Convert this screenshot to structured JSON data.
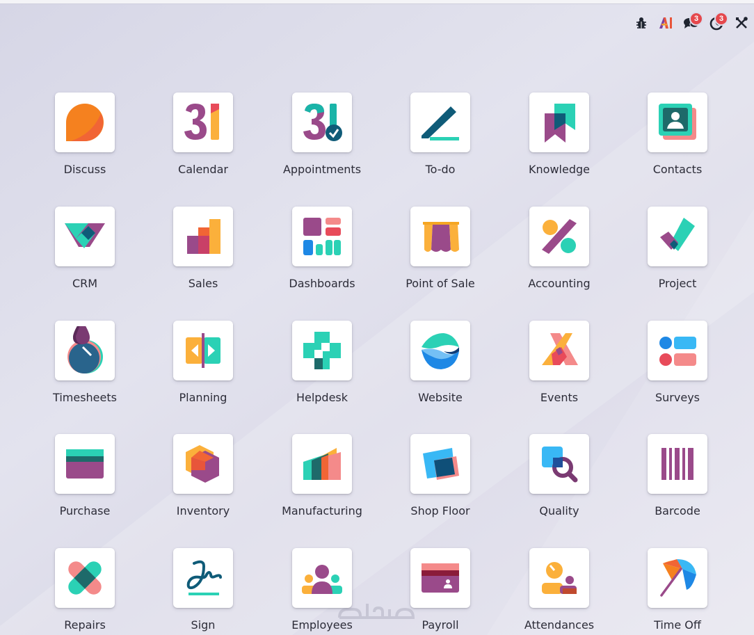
{
  "systray": {
    "chat_count": "3",
    "activity_count": "3"
  },
  "apps": [
    {
      "label": "Discuss",
      "icon": "discuss-icon"
    },
    {
      "label": "Calendar",
      "icon": "calendar-icon"
    },
    {
      "label": "Appointments",
      "icon": "appointments-icon"
    },
    {
      "label": "To-do",
      "icon": "todo-icon"
    },
    {
      "label": "Knowledge",
      "icon": "knowledge-icon"
    },
    {
      "label": "Contacts",
      "icon": "contacts-icon"
    },
    {
      "label": "CRM",
      "icon": "crm-icon"
    },
    {
      "label": "Sales",
      "icon": "sales-icon"
    },
    {
      "label": "Dashboards",
      "icon": "dashboards-icon"
    },
    {
      "label": "Point of Sale",
      "icon": "point-of-sale-icon"
    },
    {
      "label": "Accounting",
      "icon": "accounting-icon"
    },
    {
      "label": "Project",
      "icon": "project-icon"
    },
    {
      "label": "Timesheets",
      "icon": "timesheets-icon"
    },
    {
      "label": "Planning",
      "icon": "planning-icon"
    },
    {
      "label": "Helpdesk",
      "icon": "helpdesk-icon"
    },
    {
      "label": "Website",
      "icon": "website-icon"
    },
    {
      "label": "Events",
      "icon": "events-icon"
    },
    {
      "label": "Surveys",
      "icon": "surveys-icon"
    },
    {
      "label": "Purchase",
      "icon": "purchase-icon"
    },
    {
      "label": "Inventory",
      "icon": "inventory-icon"
    },
    {
      "label": "Manufacturing",
      "icon": "manufacturing-icon"
    },
    {
      "label": "Shop Floor",
      "icon": "shop-floor-icon"
    },
    {
      "label": "Quality",
      "icon": "quality-icon"
    },
    {
      "label": "Barcode",
      "icon": "barcode-icon"
    },
    {
      "label": "Repairs",
      "icon": "repairs-icon"
    },
    {
      "label": "Sign",
      "icon": "sign-icon"
    },
    {
      "label": "Employees",
      "icon": "employees-icon"
    },
    {
      "label": "Payroll",
      "icon": "payroll-icon"
    },
    {
      "label": "Attendances",
      "icon": "attendances-icon"
    },
    {
      "label": "Time Off",
      "icon": "time-off-icon"
    }
  ],
  "watermark": "خمسات"
}
